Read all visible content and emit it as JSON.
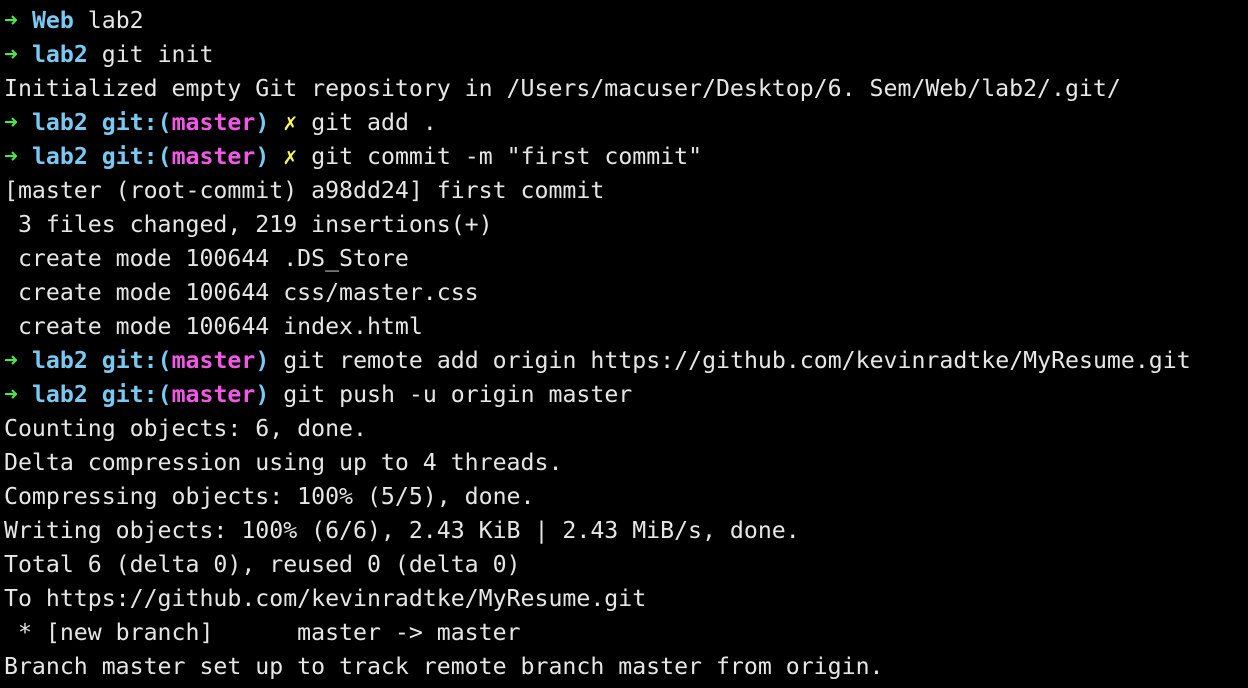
{
  "colors": {
    "background": "#000000",
    "foreground": "#e6e6e6",
    "prompt_arrow": "#4ee44e",
    "directory": "#79c9f2",
    "branch": "#f158e6",
    "dirty_marker": "#f4f75a"
  },
  "prompt_arrow": "➜",
  "git_prefix": "git:(",
  "git_suffix": ")",
  "dirty_marker": "✗",
  "lines": [
    {
      "type": "prompt",
      "dir": "Web",
      "cmd": "lab2"
    },
    {
      "type": "prompt",
      "dir": "lab2",
      "cmd": "git init"
    },
    {
      "type": "output",
      "text": "Initialized empty Git repository in /Users/macuser/Desktop/6. Sem/Web/lab2/.git/"
    },
    {
      "type": "git",
      "dir": "lab2",
      "branch": "master",
      "dirty": true,
      "cmd": "git add ."
    },
    {
      "type": "git",
      "dir": "lab2",
      "branch": "master",
      "dirty": true,
      "cmd": "git commit -m \"first commit\""
    },
    {
      "type": "output",
      "text": "[master (root-commit) a98dd24] first commit"
    },
    {
      "type": "output",
      "text": " 3 files changed, 219 insertions(+)"
    },
    {
      "type": "output",
      "text": " create mode 100644 .DS_Store"
    },
    {
      "type": "output",
      "text": " create mode 100644 css/master.css"
    },
    {
      "type": "output",
      "text": " create mode 100644 index.html"
    },
    {
      "type": "git",
      "dir": "lab2",
      "branch": "master",
      "dirty": false,
      "cmd": "git remote add origin https://github.com/kevinradtke/MyResume.git"
    },
    {
      "type": "git",
      "dir": "lab2",
      "branch": "master",
      "dirty": false,
      "cmd": "git push -u origin master"
    },
    {
      "type": "output",
      "text": "Counting objects: 6, done."
    },
    {
      "type": "output",
      "text": "Delta compression using up to 4 threads."
    },
    {
      "type": "output",
      "text": "Compressing objects: 100% (5/5), done."
    },
    {
      "type": "output",
      "text": "Writing objects: 100% (6/6), 2.43 KiB | 2.43 MiB/s, done."
    },
    {
      "type": "output",
      "text": "Total 6 (delta 0), reused 0 (delta 0)"
    },
    {
      "type": "output",
      "text": "To https://github.com/kevinradtke/MyResume.git"
    },
    {
      "type": "output",
      "text": " * [new branch]      master -> master"
    },
    {
      "type": "output",
      "text": "Branch master set up to track remote branch master from origin."
    }
  ]
}
